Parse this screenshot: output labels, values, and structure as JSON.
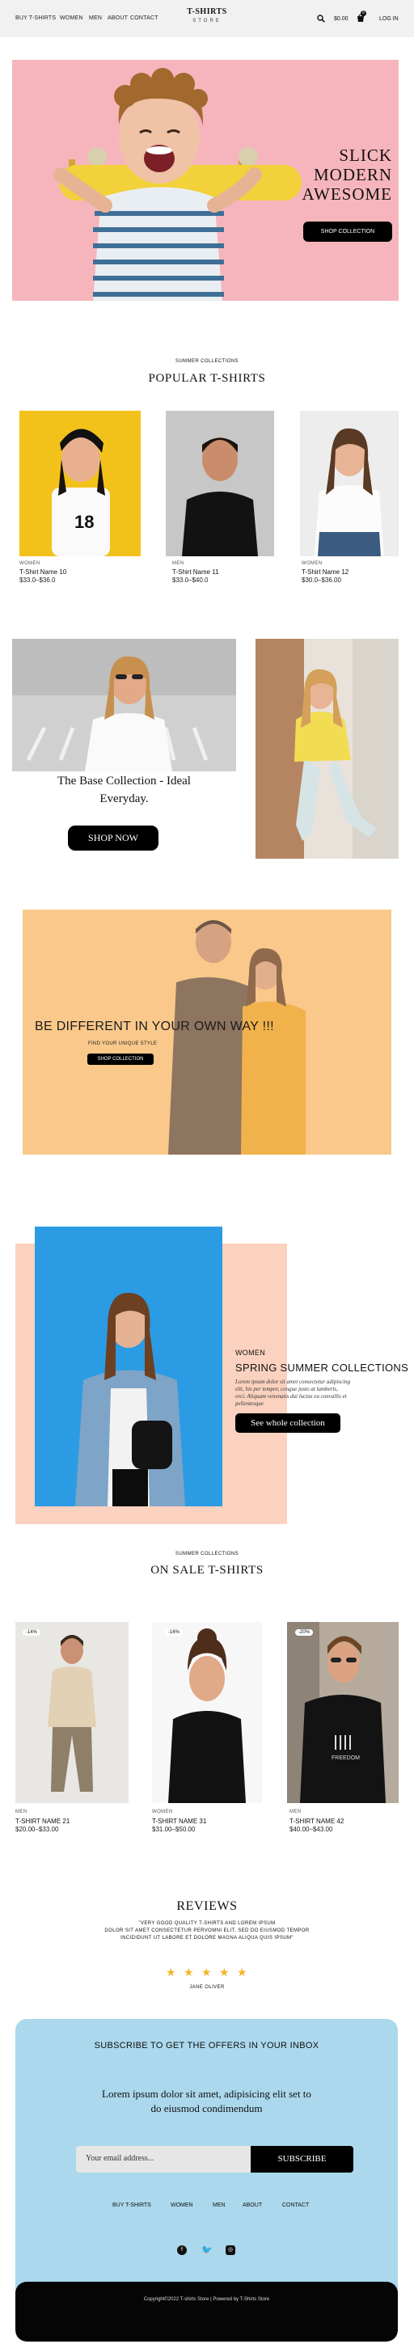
{
  "header": {
    "nav": [
      "BUY T-SHIRTS",
      "WOMEN",
      "MEN",
      "ABOUT",
      "CONTACT"
    ],
    "logo_title": "T-SHIRTS",
    "logo_sub": "STORE",
    "cart_total": "$0.00",
    "cart_count": "0",
    "login": "LOG IN"
  },
  "hero": {
    "line1": "SLICK",
    "line2": "MODERN",
    "line3": "AWESOME",
    "button": "SHOP COLLECTION"
  },
  "popular": {
    "kicker": "SUMMER COLLECTIONS",
    "title": "POPULAR T-SHIRTS",
    "products": [
      {
        "category": "WOMEN",
        "name": "T-Shirt Name 10",
        "price": "$33.0–$36.0"
      },
      {
        "category": "MEN",
        "name": "T-Shirt Name 11",
        "price": "$33.0–$40.0"
      },
      {
        "category": "WOMEN",
        "name": "T-Shirt Name 12",
        "price": "$30.0–$36.00"
      }
    ]
  },
  "base": {
    "line1": "The Base Collection - Ideal",
    "line2": "Everyday.",
    "button": "SHOP NOW"
  },
  "promo": {
    "title": "BE DIFFERENT IN YOUR OWN WAY !!!",
    "sub": "FIND YOUR UNIQUE STYLE",
    "button": "SHOP COLLECTION"
  },
  "spring": {
    "kicker": "WOMEN",
    "title": "SPRING SUMMER COLLECTIONS",
    "body_l1": "Lorem ipsum dolor sit amet consectetur adipiscing",
    "body_l2": "elit, his per tempor, congue justo at lamberts,",
    "body_l3": "orci. Aliquam venenatis dui luctus eu convallis et",
    "body_l4": "pellentesque",
    "button": "See whole collection"
  },
  "sale": {
    "kicker": "SUMMER COLLECTIONS",
    "title": "ON SALE T-SHIRTS",
    "products": [
      {
        "badge": "-14%",
        "category": "MEN",
        "name": "T-SHIRT NAME 21",
        "price": "$20.00–$33.00"
      },
      {
        "badge": "-16%",
        "category": "WOMEN",
        "name": "T-SHIRT NAME 31",
        "price": "$31.00–$50.00"
      },
      {
        "badge": "-20%",
        "category": "MEN",
        "name": "T-SHIRT NAME 42",
        "price": "$40.00–$43.00"
      }
    ]
  },
  "reviews": {
    "title": "REVIEWS",
    "line1": "\"VERY GOOD QUALITY T-SHIRTS AND LOREM IPSUM",
    "line2": "DOLOR SIT AMET CONSECTETUR PERVOMNI ELIT, SED DO EIUSMOD TEMPOR",
    "line3": "INCIDIDUNT UT LABORE ET DOLORE MAGNA ALIQUA QUIS IPSUM\"",
    "rating": 5,
    "author": "JANE OLIVER"
  },
  "footer": {
    "title": "SUBSCRIBE TO GET THE OFFERS IN YOUR INBOX",
    "body_l1": "Lorem ipsum dolor sit amet, adipisicing elit set to",
    "body_l2": "do eiusmod condimendum",
    "email_placeholder": "Your email address...",
    "subscribe": "SUBSCRIBE",
    "links": [
      "BUY T-SHIRTS",
      "WOMEN",
      "MEN",
      "ABOUT",
      "CONTACT"
    ],
    "copyright": "Copyright©2022 T-shirts Store | Powered by T-Shirts Store"
  },
  "colors": {
    "hero_bg": "#f6b5bc",
    "promo_bg": "#f9c88a",
    "spring_bg": "#fbd1bf",
    "footer_bg": "#abd8ec",
    "star": "#f3b62a"
  }
}
